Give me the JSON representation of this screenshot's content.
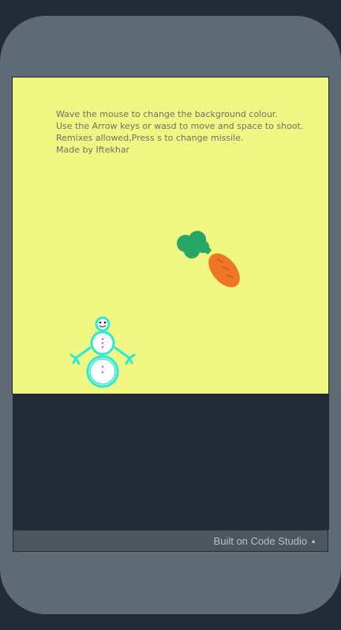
{
  "game": {
    "instructions": [
      "Wave the mouse to change the background colour.",
      "Use the Arrow keys or wasd to move and space to shoot.",
      "Remixes allowed,Press s to change missile.",
      "Made by Iftekhar"
    ],
    "background_color": "#f0f783",
    "sprites": {
      "player": "snowman-icon",
      "target": "carrot-icon"
    }
  },
  "footer": {
    "built_on_label": "Built on Code Studio",
    "caret_icon": "caret-up-icon"
  },
  "colors": {
    "frame": "#5e6b74",
    "page_bg": "#222b36",
    "snowman_outline": "#2ee8d6",
    "carrot_orange": "#ee7624",
    "carrot_leaves": "#27a664"
  }
}
